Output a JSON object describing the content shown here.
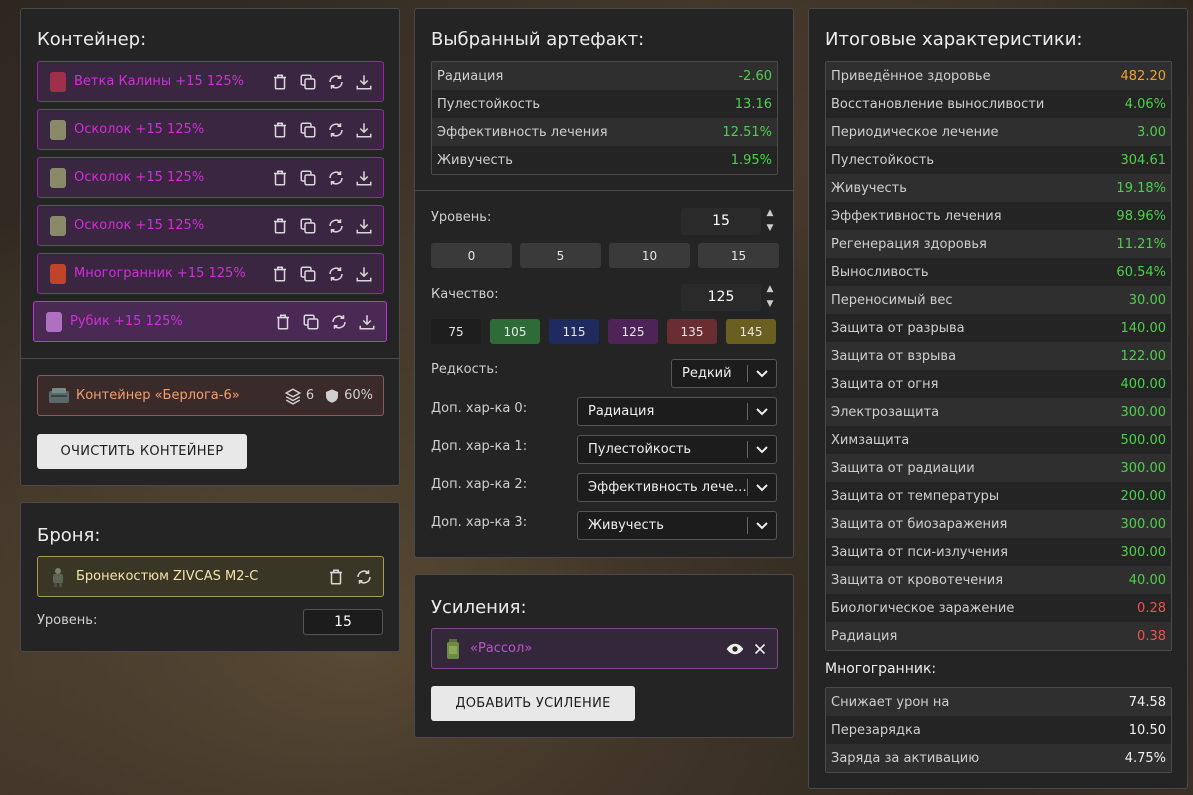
{
  "colors": {
    "panel_bg": "#242424",
    "artifact_border": "#a021b3",
    "artifact_text": "#d02fd8",
    "green": "#4cd04c",
    "orange": "#f0a030",
    "red": "#f05050"
  },
  "container": {
    "title": "Контейнер:",
    "items": [
      {
        "name": "Ветка Калины +15 125%",
        "icon": "branch-icon",
        "color": "#a0304a"
      },
      {
        "name": "Осколок +15 125%",
        "icon": "shard-icon",
        "color": "#8a8a6a"
      },
      {
        "name": "Осколок +15 125%",
        "icon": "shard-icon",
        "color": "#8a8a6a"
      },
      {
        "name": "Осколок +15 125%",
        "icon": "shard-icon",
        "color": "#8a8a6a"
      },
      {
        "name": "Многогранник +15 125%",
        "icon": "polyhedron-icon",
        "color": "#c0442a"
      },
      {
        "name": "Рубик +15 125%",
        "icon": "rubik-icon",
        "color": "#b070c0"
      }
    ],
    "selected_index": 5,
    "container_name": "Контейнер «Берлога-6»",
    "slots": "6",
    "protection": "60%",
    "clear_button": "ОЧИСТИТЬ КОНТЕЙНЕР"
  },
  "armor": {
    "title": "Броня:",
    "name": "Бронекостюм ZIVCAS M2-C",
    "level_label": "Уровень:",
    "level_value": "15"
  },
  "artifact": {
    "title": "Выбранный артефакт:",
    "stats": [
      {
        "label": "Радиация",
        "value": "-2.60",
        "tone": "green"
      },
      {
        "label": "Пулестойкость",
        "value": "13.16",
        "tone": "green"
      },
      {
        "label": "Эффективность лечения",
        "value": "12.51%",
        "tone": "green"
      },
      {
        "label": "Живучесть",
        "value": "1.95%",
        "tone": "green"
      }
    ],
    "level_label": "Уровень:",
    "level_value": "15",
    "level_presets": [
      "0",
      "5",
      "10",
      "15"
    ],
    "quality_label": "Качество:",
    "quality_value": "125",
    "quality_presets": [
      {
        "label": "75",
        "color": "#1e1e1e"
      },
      {
        "label": "105",
        "color": "#2f6b38"
      },
      {
        "label": "115",
        "color": "#1f2b5e"
      },
      {
        "label": "125",
        "color": "#4e2458"
      },
      {
        "label": "135",
        "color": "#6a2d32"
      },
      {
        "label": "145",
        "color": "#6a5e20"
      }
    ],
    "rarity_label": "Редкость:",
    "rarity_value": "Редкий",
    "extra": [
      {
        "label": "Доп. хар-ка 0:",
        "value": "Радиация"
      },
      {
        "label": "Доп. хар-ка 1:",
        "value": "Пулестойкость"
      },
      {
        "label": "Доп. хар-ка 2:",
        "value": "Эффективность лечения"
      },
      {
        "label": "Доп. хар-ка 3:",
        "value": "Живучесть"
      }
    ]
  },
  "boosts": {
    "title": "Усиления:",
    "item": "«Рассол»",
    "add_button": "ДОБАВИТЬ УСИЛЕНИЕ"
  },
  "totals": {
    "title": "Итоговые характеристики:",
    "stats": [
      {
        "label": "Приведённое здоровье",
        "value": "482.20",
        "tone": "orange"
      },
      {
        "label": "Восстановление выносливости",
        "value": "4.06%",
        "tone": "green"
      },
      {
        "label": "Периодическое лечение",
        "value": "3.00",
        "tone": "green"
      },
      {
        "label": "Пулестойкость",
        "value": "304.61",
        "tone": "green"
      },
      {
        "label": "Живучесть",
        "value": "19.18%",
        "tone": "green"
      },
      {
        "label": "Эффективность лечения",
        "value": "98.96%",
        "tone": "green"
      },
      {
        "label": "Регенерация здоровья",
        "value": "11.21%",
        "tone": "green"
      },
      {
        "label": "Выносливость",
        "value": "60.54%",
        "tone": "green"
      },
      {
        "label": "Переносимый вес",
        "value": "30.00",
        "tone": "green"
      },
      {
        "label": "Защита от разрыва",
        "value": "140.00",
        "tone": "green"
      },
      {
        "label": "Защита от взрыва",
        "value": "122.00",
        "tone": "green"
      },
      {
        "label": "Защита от огня",
        "value": "400.00",
        "tone": "green"
      },
      {
        "label": "Электрозащита",
        "value": "300.00",
        "tone": "green"
      },
      {
        "label": "Химзащита",
        "value": "500.00",
        "tone": "green"
      },
      {
        "label": "Защита от радиации",
        "value": "300.00",
        "tone": "green"
      },
      {
        "label": "Защита от температуры",
        "value": "200.00",
        "tone": "green"
      },
      {
        "label": "Защита от биозаражения",
        "value": "300.00",
        "tone": "green"
      },
      {
        "label": "Защита от пси-излучения",
        "value": "300.00",
        "tone": "green"
      },
      {
        "label": "Защита от кровотечения",
        "value": "40.00",
        "tone": "green"
      },
      {
        "label": "Биологическое заражение",
        "value": "0.28",
        "tone": "red"
      },
      {
        "label": "Радиация",
        "value": "0.38",
        "tone": "red"
      }
    ],
    "poly_title": "Многогранник:",
    "poly_stats": [
      {
        "label": "Снижает урон на",
        "value": "74.58",
        "tone": "white"
      },
      {
        "label": "Перезарядка",
        "value": "10.50",
        "tone": "white"
      },
      {
        "label": "Заряда за активацию",
        "value": "4.75%",
        "tone": "white"
      }
    ]
  }
}
